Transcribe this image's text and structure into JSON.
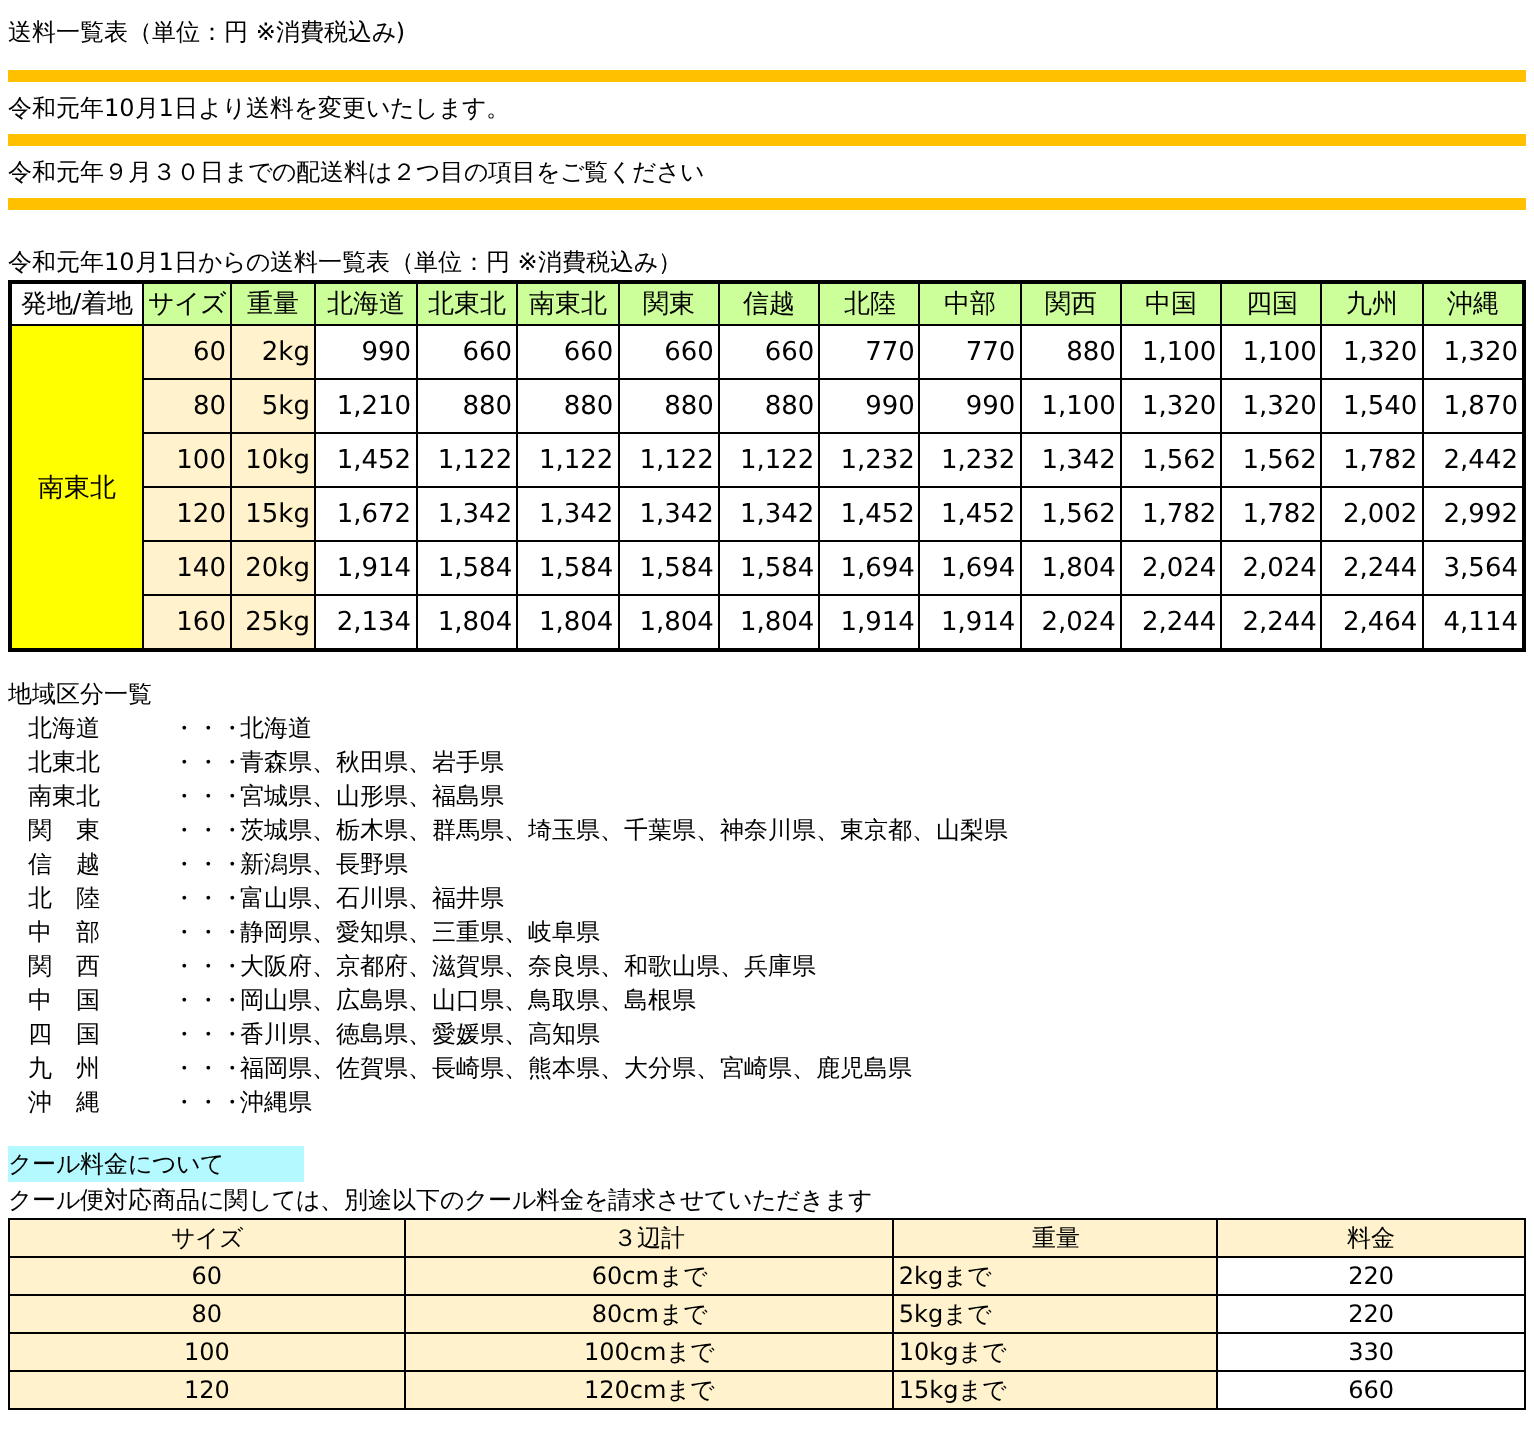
{
  "page_title": "送料一覧表（単位：円 ※消費税込み)",
  "notices": [
    "令和元年10月1日より送料を変更いたします。",
    "令和元年９月３０日までの配送料は２つ目の項目をご覧ください"
  ],
  "rate_table": {
    "caption": "令和元年10月1日からの送料一覧表（単位：円 ※消費税込み）",
    "corner": "発地/着地",
    "size_header": "サイズ",
    "weight_header": "重量",
    "regions": [
      "北海道",
      "北東北",
      "南東北",
      "関東",
      "信越",
      "北陸",
      "中部",
      "関西",
      "中国",
      "四国",
      "九州",
      "沖縄"
    ],
    "origin": "南東北",
    "rows": [
      {
        "size": "60",
        "weight": "2kg",
        "prices": [
          "990",
          "660",
          "660",
          "660",
          "660",
          "770",
          "770",
          "880",
          "1,100",
          "1,100",
          "1,320",
          "1,320"
        ]
      },
      {
        "size": "80",
        "weight": "5kg",
        "prices": [
          "1,210",
          "880",
          "880",
          "880",
          "880",
          "990",
          "990",
          "1,100",
          "1,320",
          "1,320",
          "1,540",
          "1,870"
        ]
      },
      {
        "size": "100",
        "weight": "10kg",
        "prices": [
          "1,452",
          "1,122",
          "1,122",
          "1,122",
          "1,122",
          "1,232",
          "1,232",
          "1,342",
          "1,562",
          "1,562",
          "1,782",
          "2,442"
        ]
      },
      {
        "size": "120",
        "weight": "15kg",
        "prices": [
          "1,672",
          "1,342",
          "1,342",
          "1,342",
          "1,342",
          "1,452",
          "1,452",
          "1,562",
          "1,782",
          "1,782",
          "2,002",
          "2,992"
        ]
      },
      {
        "size": "140",
        "weight": "20kg",
        "prices": [
          "1,914",
          "1,584",
          "1,584",
          "1,584",
          "1,584",
          "1,694",
          "1,694",
          "1,804",
          "2,024",
          "2,024",
          "2,244",
          "3,564"
        ]
      },
      {
        "size": "160",
        "weight": "25kg",
        "prices": [
          "2,134",
          "1,804",
          "1,804",
          "1,804",
          "1,804",
          "1,914",
          "1,914",
          "2,024",
          "2,244",
          "2,244",
          "2,464",
          "4,114"
        ]
      }
    ]
  },
  "region_list": {
    "title": "地域区分一覧",
    "items": [
      {
        "region": "北海道",
        "separator": "・・・",
        "prefectures": "北海道"
      },
      {
        "region": "北東北",
        "separator": "・・・",
        "prefectures": "青森県、秋田県、岩手県"
      },
      {
        "region": "南東北",
        "separator": "・・・",
        "prefectures": "宮城県、山形県、福島県"
      },
      {
        "region": "関　東",
        "separator": "・・・",
        "prefectures": "茨城県、栃木県、群馬県、埼玉県、千葉県、神奈川県、東京都、山梨県"
      },
      {
        "region": "信　越",
        "separator": "・・・",
        "prefectures": "新潟県、長野県"
      },
      {
        "region": "北　陸",
        "separator": "・・・",
        "prefectures": "富山県、石川県、福井県"
      },
      {
        "region": "中　部",
        "separator": "・・・",
        "prefectures": "静岡県、愛知県、三重県、岐阜県"
      },
      {
        "region": "関　西",
        "separator": "・・・",
        "prefectures": "大阪府、京都府、滋賀県、奈良県、和歌山県、兵庫県"
      },
      {
        "region": "中　国",
        "separator": "・・・",
        "prefectures": "岡山県、広島県、山口県、鳥取県、島根県"
      },
      {
        "region": "四　国",
        "separator": "・・・",
        "prefectures": "香川県、徳島県、愛媛県、高知県"
      },
      {
        "region": "九　州",
        "separator": "・・・",
        "prefectures": "福岡県、佐賀県、長崎県、熊本県、大分県、宮崎県、鹿児島県"
      },
      {
        "region": "沖　縄",
        "separator": "・・・",
        "prefectures": "沖縄県"
      }
    ]
  },
  "cool": {
    "title": "クール料金について",
    "note": "クール便対応商品に関しては、別途以下のクール料金を請求させていただきます",
    "columns": [
      "サイズ",
      "３辺計",
      "重量",
      "料金"
    ],
    "rows": [
      {
        "size": "60",
        "dimensions": "60cmまで",
        "weight": "2kgまで",
        "fee": "220"
      },
      {
        "size": "80",
        "dimensions": "80cmまで",
        "weight": "5kgまで",
        "fee": "220"
      },
      {
        "size": "100",
        "dimensions": "100cmまで",
        "weight": "10kgまで",
        "fee": "330"
      },
      {
        "size": "120",
        "dimensions": "120cmまで",
        "weight": "15kgまで",
        "fee": "660"
      }
    ]
  }
}
